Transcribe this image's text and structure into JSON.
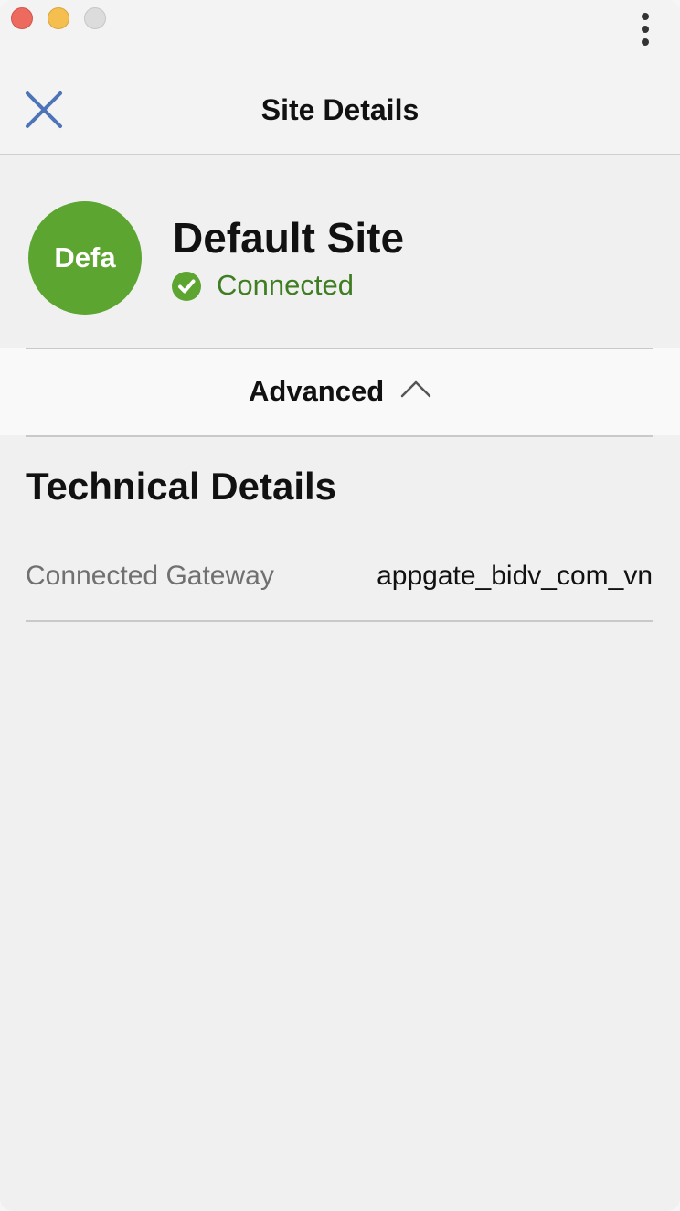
{
  "window": {
    "controls": [
      "close",
      "minimize",
      "maximize"
    ],
    "more_menu_icon": "more-vertical-icon"
  },
  "header": {
    "title": "Site Details",
    "close_icon": "close-icon"
  },
  "site": {
    "avatar_text": "Defa",
    "name": "Default Site",
    "status": "Connected",
    "status_icon": "check-circle-icon",
    "avatar_color": "#5ba530",
    "status_color": "#3f7d22"
  },
  "advanced": {
    "label": "Advanced",
    "expanded_icon": "chevron-up-icon"
  },
  "technical_details": {
    "title": "Technical Details",
    "rows": [
      {
        "label": "Connected Gateway",
        "value": "appgate_bidv_com_vn"
      }
    ]
  },
  "colors": {
    "accent": "#4d74b8",
    "close_button": "#ec6a5e",
    "minimize_button": "#f4bf4f",
    "maximize_button": "#dcdcdc"
  }
}
